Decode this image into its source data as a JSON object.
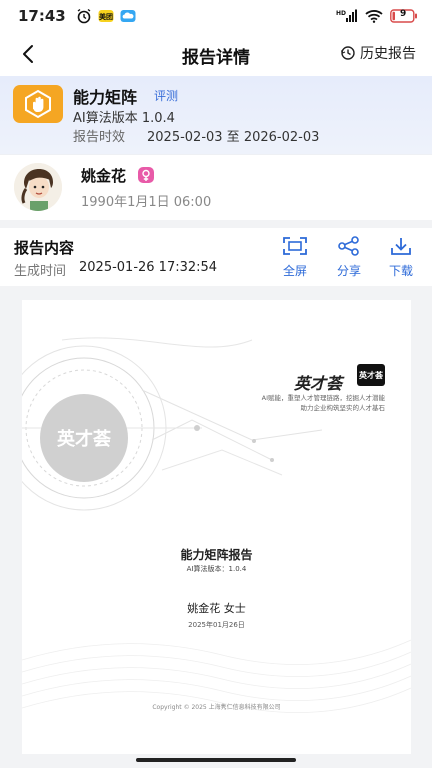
{
  "status_bar": {
    "time": "17:43",
    "battery": "9",
    "network": "HD"
  },
  "nav": {
    "title": "报告详情",
    "history_label": "历史报告"
  },
  "report": {
    "name": "能力矩阵",
    "tag": "评测",
    "algo_version": "AI算法版本 1.0.4",
    "validity_label": "报告时效",
    "validity_value": "2025-02-03 至 2026-02-03"
  },
  "person": {
    "name": "姚金花",
    "birth": "1990年1月1日 06:00"
  },
  "content": {
    "title": "报告内容",
    "gen_label": "生成时间",
    "gen_value": "2025-01-26 17:32:54",
    "actions": {
      "fullscreen": "全屏",
      "share": "分享",
      "download": "下载"
    }
  },
  "document": {
    "brand": "英才荟",
    "brand_logo_text": "英才荟",
    "watermark_text": "英才荟",
    "slogan_line1": "AI赋能，重塑人才管理链路，挖掘人才潜能",
    "slogan_line2": "助力企业构筑坚实的人才基石",
    "report_title": "能力矩阵报告",
    "algo": "AI算法版本：1.0.4",
    "person_line": "姚金花  女士",
    "date": "2025年01月26日",
    "copyright": "Copyright © 2025 上海隽仁信息科技有限公司"
  },
  "colors": {
    "accent": "#2d6ad8",
    "logo": "#f5a623",
    "gender_badge": "#e85aa8"
  }
}
